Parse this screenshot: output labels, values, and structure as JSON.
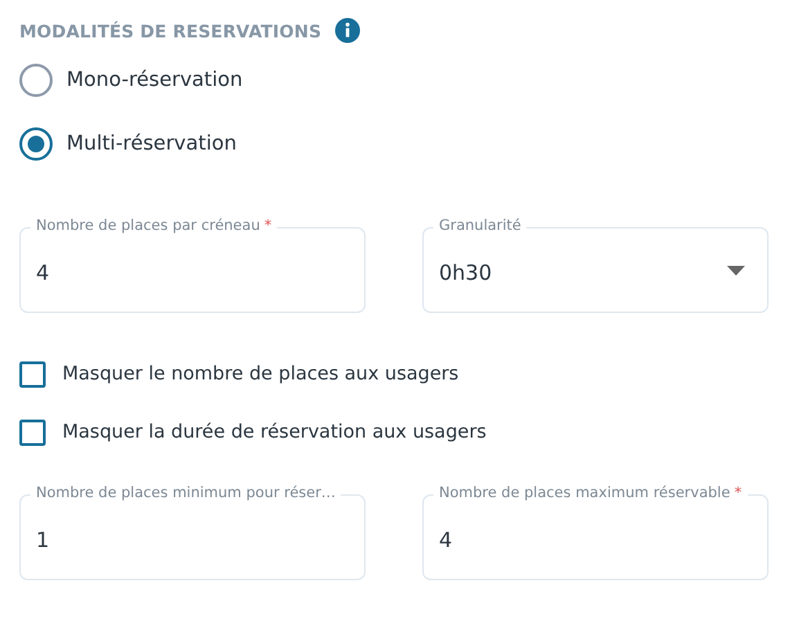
{
  "section": {
    "title": "MODALITÉS DE RESERVATIONS"
  },
  "modes": [
    {
      "label": "Mono-réservation",
      "selected": false
    },
    {
      "label": "Multi-réservation",
      "selected": true
    }
  ],
  "fields_top": [
    {
      "kind": "text",
      "label": "Nombre de places par créneau",
      "required_mark": "*",
      "value": "4"
    },
    {
      "kind": "select",
      "label": "Granularité",
      "value": "0h30"
    }
  ],
  "options": [
    {
      "label": "Masquer le nombre de places aux usagers",
      "checked": false
    },
    {
      "label": "Masquer la durée de réservation aux usagers",
      "checked": false
    }
  ],
  "fields_bottom": [
    {
      "kind": "text",
      "label": "Nombre de places minimum pour réser…",
      "value": "1"
    },
    {
      "kind": "text",
      "label": "Nombre de places maximum réservable",
      "required_mark": "*",
      "value": "4"
    }
  ]
}
